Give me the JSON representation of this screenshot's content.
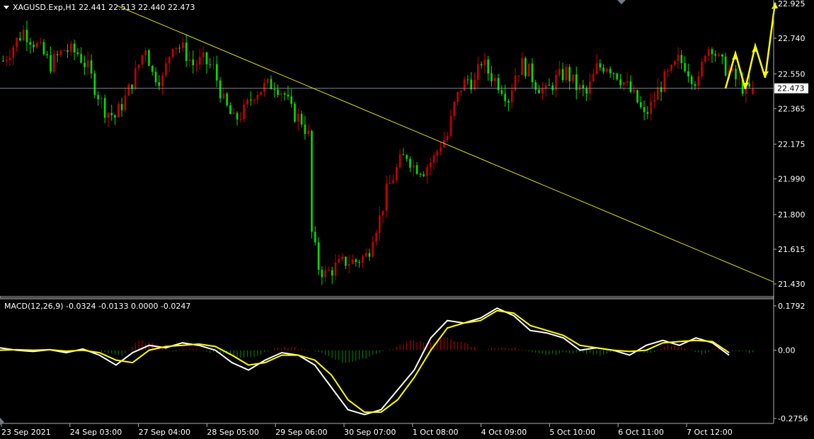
{
  "header": {
    "symbol_line": "XAGUSD.Exp,H1  22.441 22.513 22.440 22.473"
  },
  "macd_panel": {
    "label": "MACD(12,26,9) -0.0324 -0.0133 0.0000 -0.0247"
  },
  "colors": {
    "background": "#000000",
    "bull_candle": "#00e000",
    "bear_candle": "#c80000",
    "trendline": "#e0e000",
    "projection_arrow": "#ffff00",
    "macd_line": "#ffffff",
    "signal_line": "#ffff00",
    "hist_positive": "#c00000",
    "hist_negative": "#008a00",
    "axis_text": "#ffffff",
    "frame": "#b0b0b0"
  },
  "chart_data": [
    {
      "type": "candlestick",
      "symbol": "XAGUSD.Exp",
      "timeframe": "H1",
      "ohlc_last": {
        "open": 22.441,
        "high": 22.513,
        "low": 22.44,
        "close": 22.473
      },
      "current_price": 22.473,
      "y_ticks": [
        "22.925",
        "22.740",
        "22.550",
        "22.365",
        "22.175",
        "21.990",
        "21.800",
        "21.615",
        "21.430"
      ],
      "ylim": [
        21.38,
        22.93
      ],
      "x_ticks": [
        "23 Sep 2021",
        "24 Sep 03:00",
        "27 Sep 04:00",
        "28 Sep 05:00",
        "29 Sep 06:00",
        "30 Sep 07:00",
        "1 Oct 08:00",
        "4 Oct 09:00",
        "5 Oct 10:00",
        "6 Oct 11:00",
        "7 Oct 12:00"
      ],
      "close_path": [
        [
          0,
          22.62
        ],
        [
          6,
          22.78
        ],
        [
          10,
          22.7
        ],
        [
          14,
          22.6
        ],
        [
          18,
          22.68
        ],
        [
          22,
          22.66
        ],
        [
          25,
          22.58
        ],
        [
          27,
          22.48
        ],
        [
          30,
          22.36
        ],
        [
          33,
          22.32
        ],
        [
          36,
          22.42
        ],
        [
          39,
          22.55
        ],
        [
          42,
          22.7
        ],
        [
          44,
          22.55
        ],
        [
          47,
          22.52
        ],
        [
          50,
          22.72
        ],
        [
          53,
          22.68
        ],
        [
          56,
          22.6
        ],
        [
          59,
          22.62
        ],
        [
          62,
          22.58
        ],
        [
          65,
          22.4
        ],
        [
          68,
          22.3
        ],
        [
          71,
          22.35
        ],
        [
          74,
          22.45
        ],
        [
          77,
          22.48
        ],
        [
          80,
          22.5
        ],
        [
          83,
          22.44
        ],
        [
          85,
          22.35
        ],
        [
          88,
          22.3
        ],
        [
          90,
          22.22
        ],
        [
          91,
          21.7
        ],
        [
          93,
          21.52
        ],
        [
          95,
          21.48
        ],
        [
          98,
          21.52
        ],
        [
          101,
          21.55
        ],
        [
          104,
          21.55
        ],
        [
          107,
          21.58
        ],
        [
          108,
          21.62
        ],
        [
          109,
          21.7
        ],
        [
          111,
          21.78
        ],
        [
          113,
          21.92
        ],
        [
          115,
          22.0
        ],
        [
          117,
          22.08
        ],
        [
          119,
          22.12
        ],
        [
          121,
          22.06
        ],
        [
          124,
          22.04
        ],
        [
          127,
          22.1
        ],
        [
          129,
          22.18
        ],
        [
          131,
          22.22
        ],
        [
          133,
          22.38
        ],
        [
          135,
          22.48
        ],
        [
          137,
          22.52
        ],
        [
          139,
          22.5
        ],
        [
          141,
          22.62
        ],
        [
          143,
          22.56
        ],
        [
          145,
          22.52
        ],
        [
          147,
          22.48
        ],
        [
          149,
          22.42
        ],
        [
          151,
          22.55
        ],
        [
          153,
          22.6
        ],
        [
          155,
          22.56
        ],
        [
          157,
          22.5
        ],
        [
          160,
          22.45
        ],
        [
          163,
          22.52
        ],
        [
          166,
          22.56
        ],
        [
          169,
          22.48
        ],
        [
          172,
          22.44
        ],
        [
          175,
          22.58
        ],
        [
          178,
          22.6
        ],
        [
          181,
          22.55
        ],
        [
          184,
          22.48
        ],
        [
          187,
          22.4
        ],
        [
          189,
          22.32
        ],
        [
          191,
          22.38
        ],
        [
          193,
          22.46
        ],
        [
          195,
          22.52
        ],
        [
          197,
          22.56
        ],
        [
          199,
          22.62
        ],
        [
          201,
          22.6
        ],
        [
          203,
          22.54
        ],
        [
          205,
          22.5
        ],
        [
          207,
          22.68
        ],
        [
          209,
          22.7
        ],
        [
          211,
          22.62
        ],
        [
          213,
          22.58
        ],
        [
          215,
          22.54
        ],
        [
          217,
          22.5
        ],
        [
          219,
          22.46
        ],
        [
          221,
          22.473
        ]
      ],
      "trendline": {
        "from": [
          "23 Sep 2021",
          23.1
        ],
        "to": [
          "7 Oct 12:00 +",
          21.42
        ]
      },
      "projection_points": [
        22.473,
        22.66,
        22.47,
        22.7,
        22.53,
        22.93
      ],
      "horizontal_line": 22.473
    },
    {
      "type": "line",
      "title": "MACD(12,26,9)",
      "y_ticks": [
        "0.1792",
        "0.00",
        "-0.2756"
      ],
      "ylim": [
        -0.2756,
        0.1792
      ],
      "series": [
        {
          "name": "MACD",
          "values": [
            0.01,
            0.0,
            -0.005,
            0.002,
            -0.01,
            0.005,
            -0.02,
            -0.06,
            -0.01,
            0.02,
            0.01,
            0.03,
            0.02,
            0.0,
            -0.05,
            -0.08,
            -0.04,
            -0.01,
            -0.02,
            -0.06,
            -0.15,
            -0.24,
            -0.26,
            -0.24,
            -0.16,
            -0.08,
            0.05,
            0.12,
            0.11,
            0.13,
            0.17,
            0.14,
            0.08,
            0.07,
            0.05,
            0.0,
            0.01,
            0.0,
            -0.02,
            0.02,
            0.04,
            0.02,
            0.05,
            0.03,
            -0.02
          ]
        },
        {
          "name": "Signal",
          "values": [
            0.0,
            0.002,
            0.0,
            0.002,
            -0.004,
            0.0,
            -0.01,
            -0.04,
            -0.05,
            0.0,
            0.015,
            0.02,
            0.025,
            0.015,
            -0.02,
            -0.06,
            -0.05,
            -0.02,
            -0.02,
            -0.04,
            -0.1,
            -0.2,
            -0.25,
            -0.25,
            -0.2,
            -0.11,
            0.0,
            0.09,
            0.11,
            0.12,
            0.16,
            0.15,
            0.1,
            0.08,
            0.06,
            0.02,
            0.01,
            0.0,
            -0.005,
            0.0,
            0.03,
            0.035,
            0.04,
            0.035,
            -0.01
          ]
        }
      ],
      "histogram": [
        0.01,
        -0.002,
        -0.005,
        0.0,
        -0.006,
        0.005,
        -0.01,
        -0.02,
        0.04,
        0.02,
        -0.005,
        0.01,
        -0.005,
        -0.015,
        -0.03,
        -0.02,
        0.01,
        0.01,
        0.0,
        -0.02,
        -0.05,
        -0.04,
        -0.01,
        0.01,
        0.04,
        0.03,
        0.05,
        0.03,
        0.0,
        0.01,
        0.01,
        -0.01,
        -0.02,
        -0.01,
        -0.01,
        -0.02,
        0.0,
        0.0,
        -0.015,
        0.02,
        0.01,
        -0.015,
        0.01,
        -0.005,
        -0.01
      ]
    }
  ]
}
